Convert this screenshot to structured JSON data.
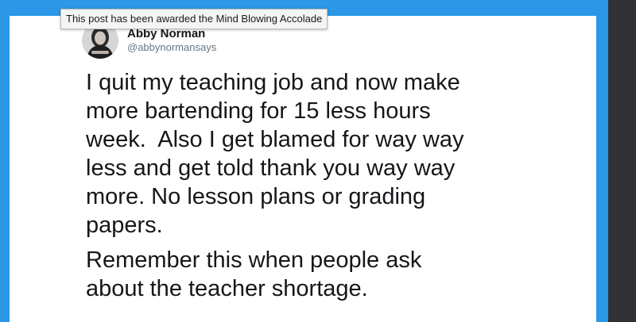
{
  "tooltip": {
    "text": "This post has been awarded the Mind Blowing Accolade"
  },
  "tweet": {
    "author": {
      "display_name": "Abby Norman",
      "handle": "@abbynormansays",
      "avatar_icon": "profile-photo"
    },
    "paragraphs": [
      "I quit my teaching job and now make\nmore bartending for 15 less hours\nweek.  Also I get blamed for way way\nless and get told thank you way way\nmore. No lesson plans or grading\npapers.",
      "Remember this when people ask\nabout the teacher shortage."
    ]
  },
  "colors": {
    "frame_blue": "#2b97e6",
    "dark_strip": "#303134",
    "card_background": "#ffffff",
    "text_primary": "#14171a",
    "text_secondary": "#657786"
  }
}
